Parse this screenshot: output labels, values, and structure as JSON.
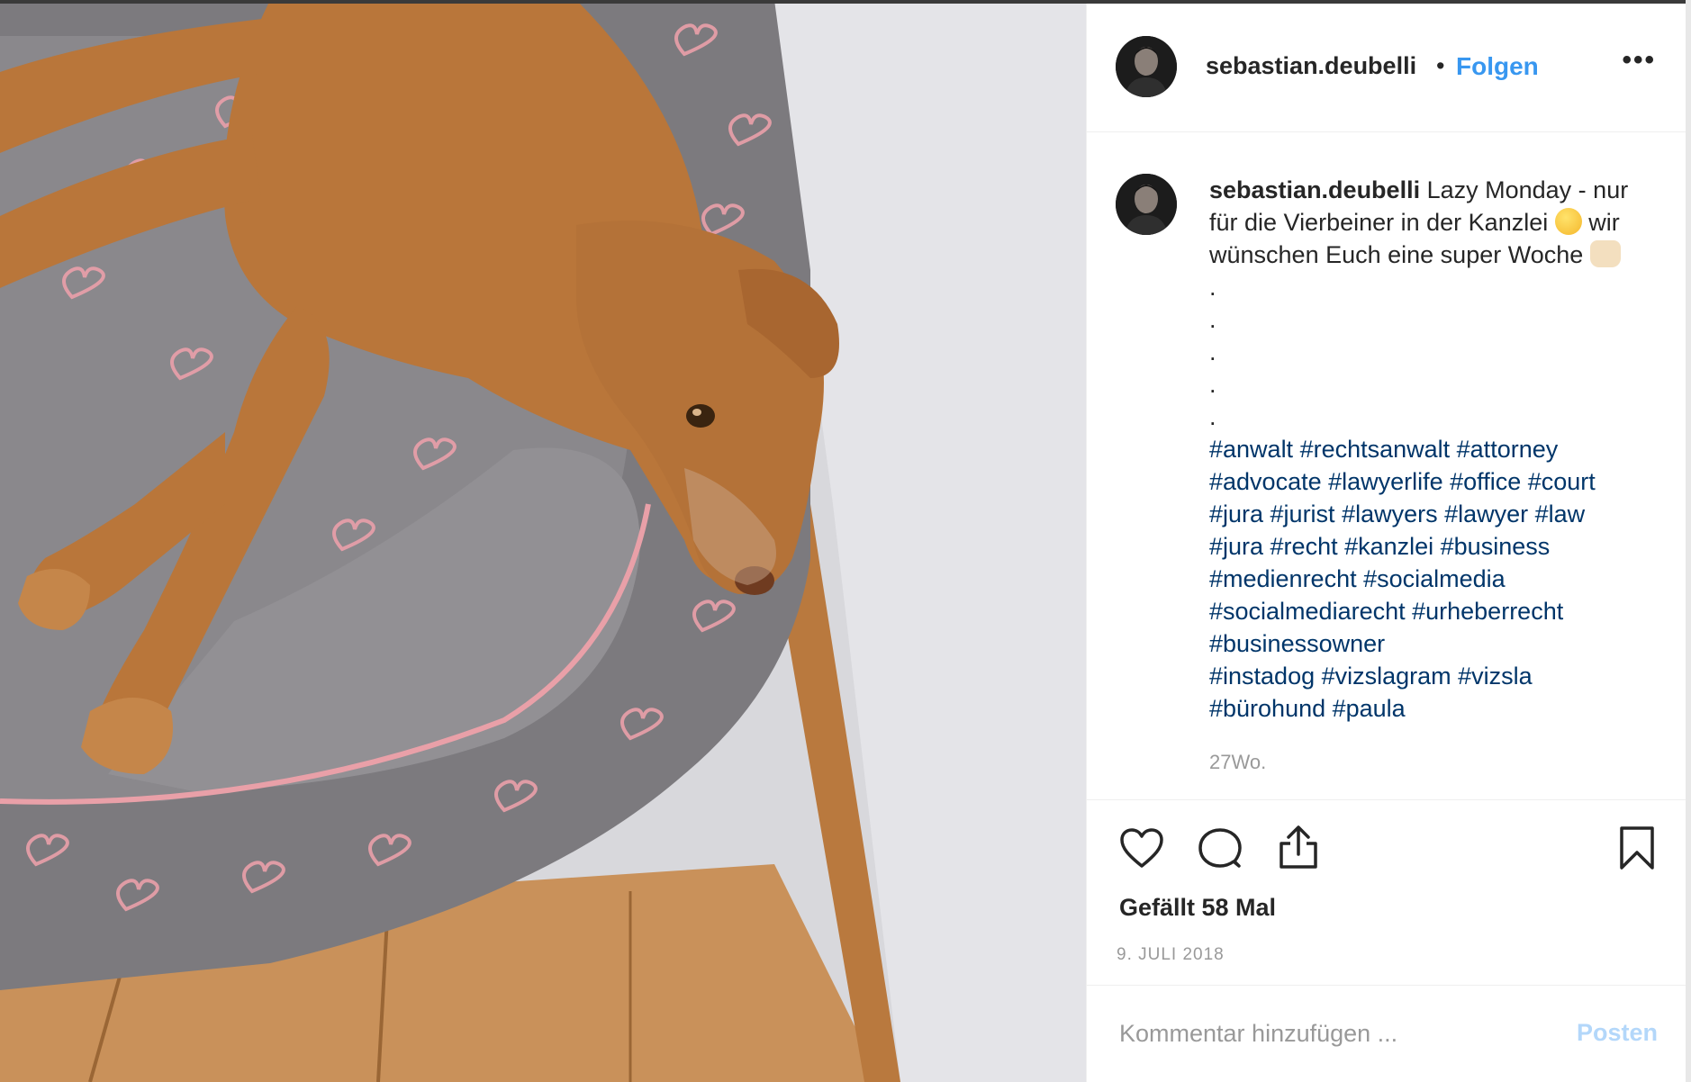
{
  "post": {
    "username": "sebastian.deubelli",
    "separator": "•",
    "follow_label": "Folgen",
    "more_label": "•••"
  },
  "caption": {
    "username": "sebastian.deubelli",
    "text_part1": "Lazy Monday - nur für die Vierbeiner in der Kanzlei",
    "text_part2": "wir wünschen Euch eine super Woche",
    "dots": [
      ".",
      ".",
      ".",
      ".",
      "."
    ],
    "hashtag_lines": [
      "#anwalt #rechtsanwalt #attorney",
      "#advocate #lawyerlife #office #court",
      "#jura #jurist #lawyers #lawyer #law",
      "#jura #recht #kanzlei #business",
      "#medienrecht #socialmedia",
      "#socialmediarecht #urheberrecht",
      "#businessowner",
      "#instadog #vizslagram #vizsla",
      "#bürohund #paula"
    ],
    "time": "27Wo."
  },
  "actions": {
    "like_icon": "heart-icon",
    "comment_icon": "comment-icon",
    "share_icon": "share-icon",
    "save_icon": "bookmark-icon",
    "likes_text": "Gefällt 58 Mal",
    "date": "9. JULI 2018"
  },
  "comment_box": {
    "placeholder": "Kommentar hinzufügen ...",
    "post_label": "Posten"
  },
  "colors": {
    "link": "#3897f0",
    "hashtag": "#003569",
    "muted": "#999999",
    "post_disabled": "#b3d7fa"
  }
}
